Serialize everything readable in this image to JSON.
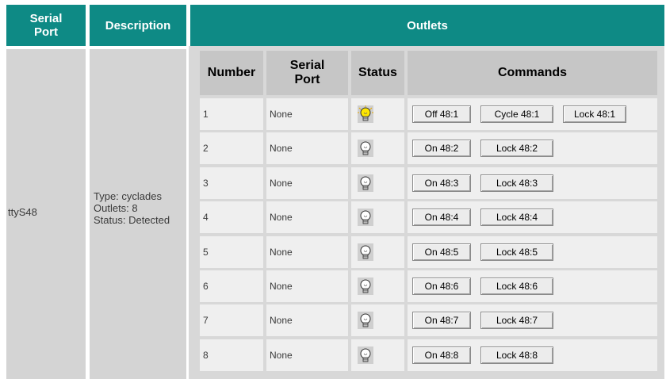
{
  "header": {
    "serial_port_label": "Serial\nPort",
    "description_label": "Description",
    "outlets_label": "Outlets"
  },
  "device": {
    "port": "ttyS48",
    "type": "Type: cyclades",
    "outlets": "Outlets: 8",
    "status": "Status: Detected"
  },
  "table": {
    "columns": [
      "Number",
      "Serial\nPort",
      "Status",
      "Commands"
    ],
    "rows": [
      {
        "number": "1",
        "serial_port": "None",
        "status_icon": "bulb-on-icon",
        "commands": [
          "Off 48:1",
          "Cycle 48:1",
          "Lock 48:1"
        ]
      },
      {
        "number": "2",
        "serial_port": "None",
        "status_icon": "bulb-off-icon",
        "commands": [
          "On 48:2",
          "Lock 48:2"
        ]
      },
      {
        "number": "3",
        "serial_port": "None",
        "status_icon": "bulb-off-icon",
        "commands": [
          "On 48:3",
          "Lock 48:3"
        ]
      },
      {
        "number": "4",
        "serial_port": "None",
        "status_icon": "bulb-off-icon",
        "commands": [
          "On 48:4",
          "Lock 48:4"
        ]
      },
      {
        "number": "5",
        "serial_port": "None",
        "status_icon": "bulb-off-icon",
        "commands": [
          "On 48:5",
          "Lock 48:5"
        ]
      },
      {
        "number": "6",
        "serial_port": "None",
        "status_icon": "bulb-off-icon",
        "commands": [
          "On 48:6",
          "Lock 48:6"
        ]
      },
      {
        "number": "7",
        "serial_port": "None",
        "status_icon": "bulb-off-icon",
        "commands": [
          "On 48:7",
          "Lock 48:7"
        ]
      },
      {
        "number": "8",
        "serial_port": "None",
        "status_icon": "bulb-off-icon",
        "commands": [
          "On 48:8",
          "Lock 48:8"
        ]
      }
    ]
  },
  "colors": {
    "header_bg": "#0e8a85",
    "bulb_on": "#ffe600"
  }
}
